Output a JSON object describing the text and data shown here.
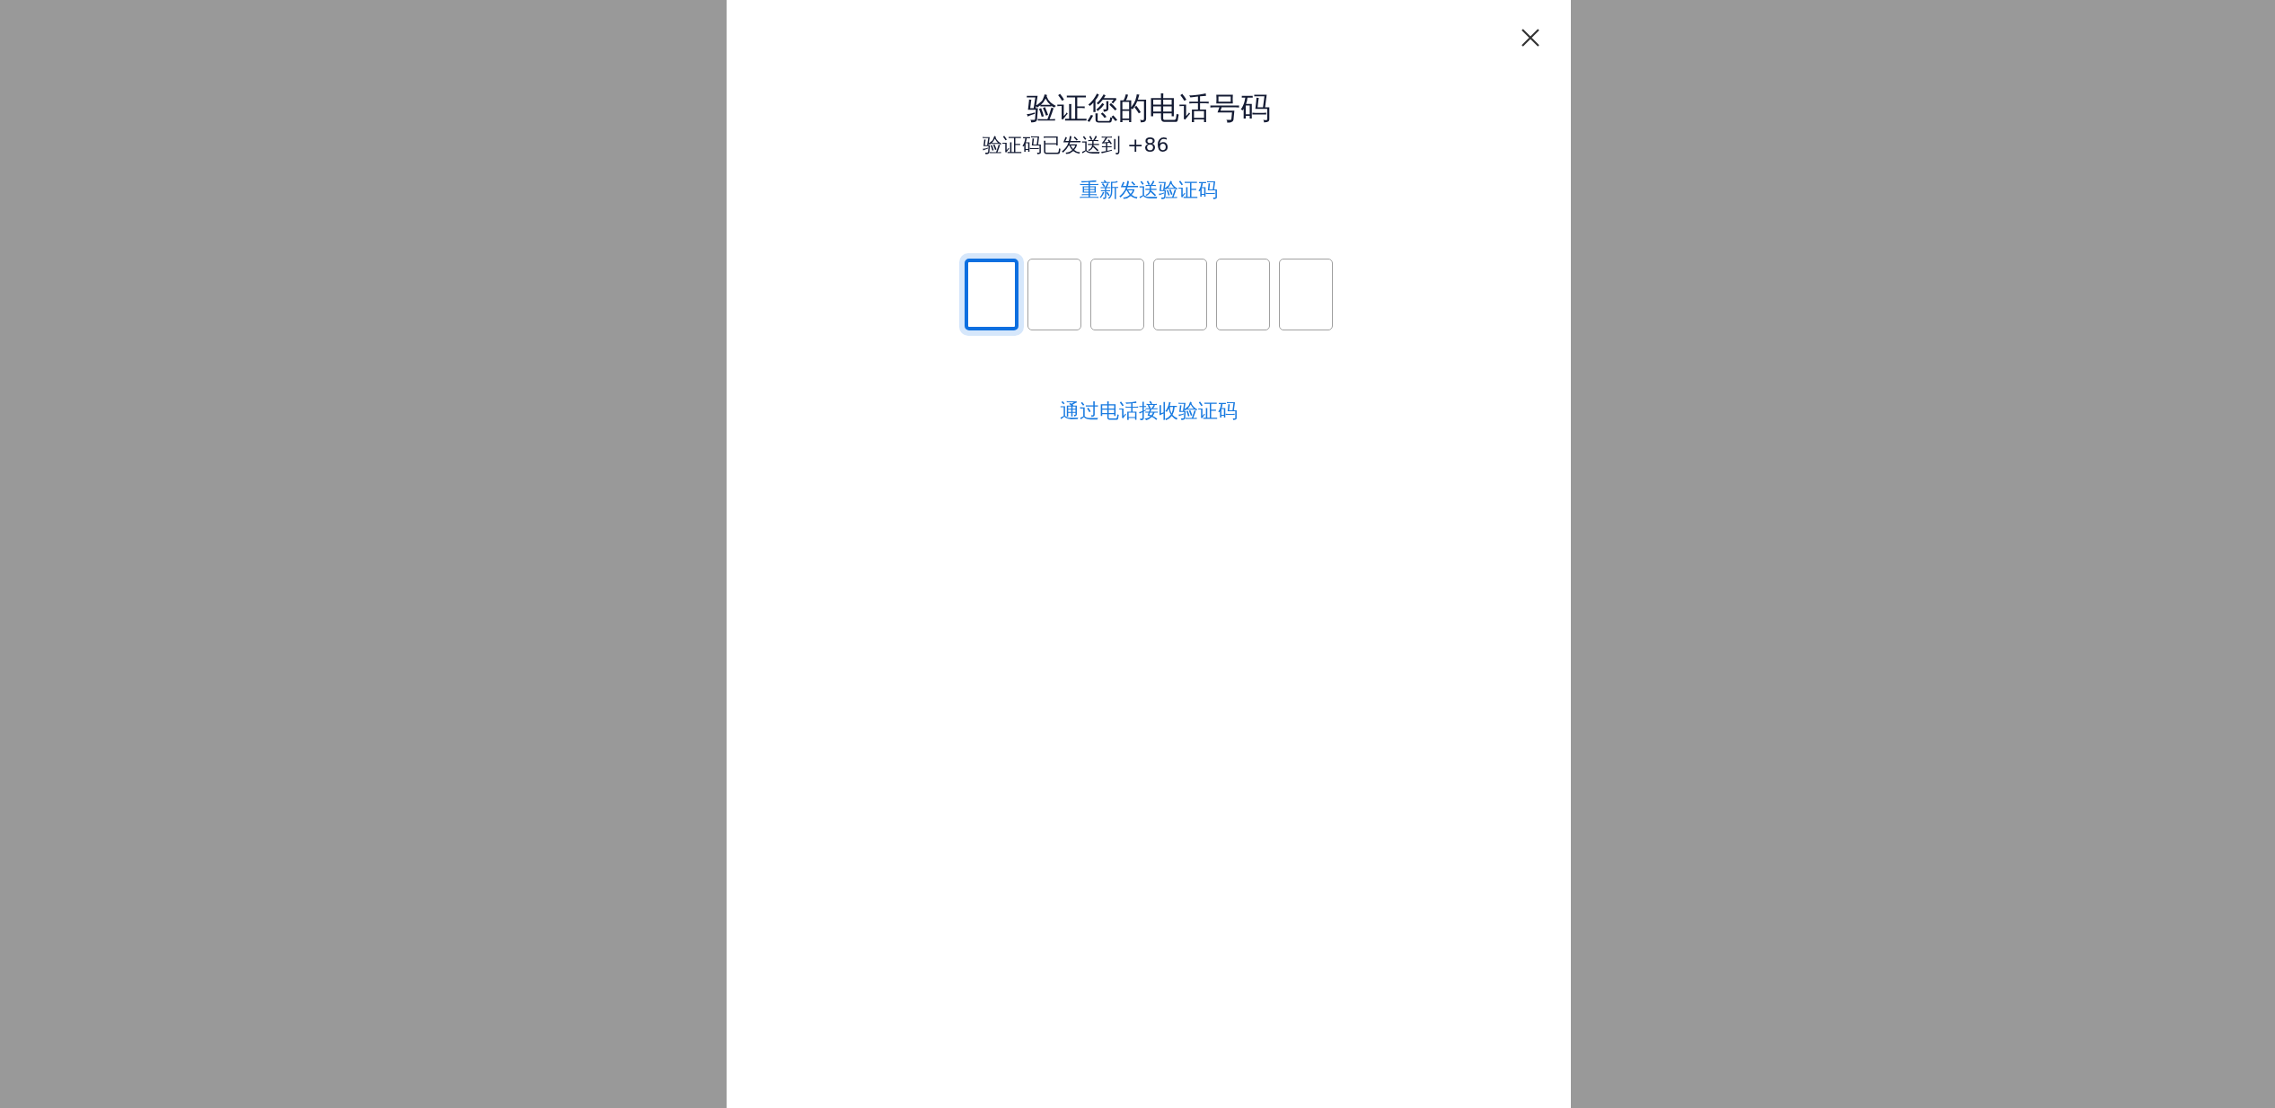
{
  "dialog": {
    "title": "验证您的电话号码",
    "subtitle": "验证码已发送到 +86",
    "resend_link": "重新发送验证码",
    "code_boxes": [
      {
        "selected": true
      },
      {
        "selected": false
      },
      {
        "selected": false
      },
      {
        "selected": false
      },
      {
        "selected": false
      },
      {
        "selected": false
      }
    ],
    "call_link": "通过电话接收验证码"
  }
}
